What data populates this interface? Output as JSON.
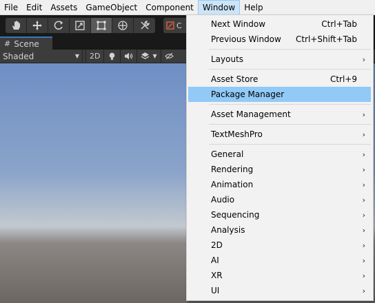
{
  "menubar": {
    "items": [
      "File",
      "Edit",
      "Assets",
      "GameObject",
      "Component",
      "Window",
      "Help"
    ],
    "active": "Window"
  },
  "toolbar": {
    "tools": [
      "hand-tool",
      "move-tool",
      "rotate-tool",
      "scale-tool",
      "rect-tool",
      "transform-tool",
      "custom-tool"
    ],
    "selected": "rect-tool",
    "pivot_label": "C"
  },
  "scene": {
    "tab_label": "Scene",
    "shading_mode": "Shaded",
    "mode_2d_label": "2D"
  },
  "window_menu": {
    "groups": [
      [
        {
          "label": "Next Window",
          "shortcut": "Ctrl+Tab",
          "submenu": false
        },
        {
          "label": "Previous Window",
          "shortcut": "Ctrl+Shift+Tab",
          "submenu": false
        }
      ],
      [
        {
          "label": "Layouts",
          "shortcut": "",
          "submenu": true
        }
      ],
      [
        {
          "label": "Asset Store",
          "shortcut": "Ctrl+9",
          "submenu": false
        },
        {
          "label": "Package Manager",
          "shortcut": "",
          "submenu": false,
          "highlighted": true
        }
      ],
      [
        {
          "label": "Asset Management",
          "shortcut": "",
          "submenu": true
        }
      ],
      [
        {
          "label": "TextMeshPro",
          "shortcut": "",
          "submenu": true
        }
      ],
      [
        {
          "label": "General",
          "shortcut": "",
          "submenu": true
        },
        {
          "label": "Rendering",
          "shortcut": "",
          "submenu": true
        },
        {
          "label": "Animation",
          "shortcut": "",
          "submenu": true
        },
        {
          "label": "Audio",
          "shortcut": "",
          "submenu": true
        },
        {
          "label": "Sequencing",
          "shortcut": "",
          "submenu": true
        },
        {
          "label": "Analysis",
          "shortcut": "",
          "submenu": true
        },
        {
          "label": "2D",
          "shortcut": "",
          "submenu": true
        },
        {
          "label": "AI",
          "shortcut": "",
          "submenu": true
        },
        {
          "label": "XR",
          "shortcut": "",
          "submenu": true
        },
        {
          "label": "UI",
          "shortcut": "",
          "submenu": true
        }
      ]
    ],
    "submenu_arrow": "›"
  },
  "colors": {
    "highlight": "#91c9f7",
    "active_menu": "#cce4f7",
    "toolbar_bg": "#191919",
    "sky_top": "#6f8fc4",
    "ground": "#6c6663"
  }
}
